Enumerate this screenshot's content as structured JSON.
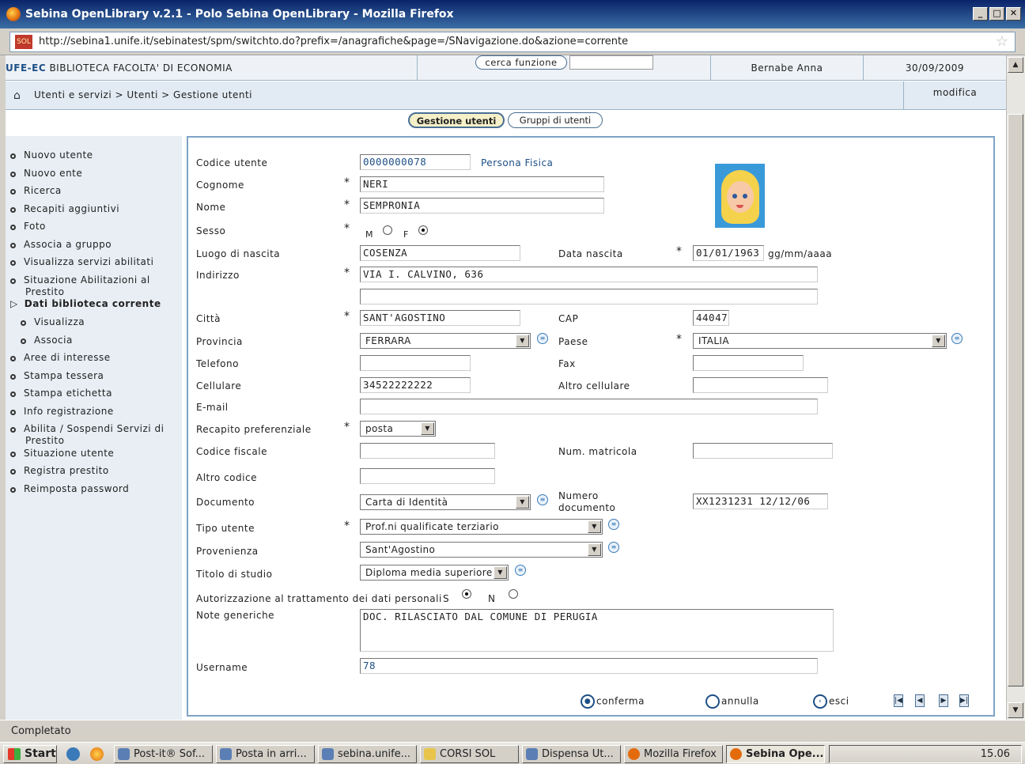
{
  "window": {
    "title": "Sebina OpenLibrary v.2.1 - Polo Sebina OpenLibrary - Mozilla Firefox"
  },
  "url": "http://sebina1.unife.it/sebinatest/spm/switchto.do?prefix=/anagrafiche&page=/SNavigazione.do&azione=corrente",
  "header": {
    "library_code": "UFE-EC",
    "library_name": "BIBLIOTECA FACOLTA' DI ECONOMIA",
    "search_label": "cerca funzione",
    "user": "Bernabe Anna",
    "date": "30/09/2009"
  },
  "breadcrumb": {
    "path": "Utenti e servizi > Utenti > Gestione utenti",
    "modify": "modifica"
  },
  "tabs": [
    "Gestione utenti",
    "Gruppi di utenti"
  ],
  "menu": [
    "Nuovo utente",
    "Nuovo ente",
    "Ricerca",
    "Recapiti aggiuntivi",
    "Foto",
    "Associa a gruppo",
    "Visualizza servizi abilitati",
    "Situazione Abilitazioni al Prestito",
    "Dati biblioteca corrente",
    "Visualizza",
    "Associa",
    "Aree di interesse",
    "Stampa tessera",
    "Stampa etichetta",
    "Info registrazione",
    "Abilita / Sospendi Servizi di Prestito",
    "Situazione utente",
    "Registra prestito",
    "Reimposta password"
  ],
  "form": {
    "codice_utente_label": "Codice utente",
    "codice_utente": "0000000078",
    "persona_fisica": "Persona Fisica",
    "cognome_label": "Cognome",
    "cognome": "NERI",
    "nome_label": "Nome",
    "nome": "SEMPRONIA",
    "sesso_label": "Sesso",
    "m": "M",
    "f": "F",
    "luogo_label": "Luogo di nascita",
    "luogo": "COSENZA",
    "data_label": "Data nascita",
    "data": "01/01/1963",
    "data_fmt": "gg/mm/aaaa",
    "indirizzo_label": "Indirizzo",
    "indirizzo": "VIA I. CALVINO, 636",
    "indirizzo2": "",
    "citta_label": "Città",
    "citta": "SANT'AGOSTINO",
    "cap_label": "CAP",
    "cap": "44047",
    "provincia_label": "Provincia",
    "provincia": "FERRARA",
    "paese_label": "Paese",
    "paese": "ITALIA",
    "telefono_label": "Telefono",
    "fax_label": "Fax",
    "cellulare_label": "Cellulare",
    "cellulare": "34522222222",
    "altro_cell_label": "Altro cellulare",
    "email_label": "E-mail",
    "recapito_label": "Recapito preferenziale",
    "recapito": "posta",
    "cf_label": "Codice fiscale",
    "matricola_label": "Num. matricola",
    "altro_codice_label": "Altro codice",
    "documento_label": "Documento",
    "documento": "Carta di Identità",
    "numdoc_label1": "Numero",
    "numdoc_label2": "documento",
    "numdoc": "XX1231231  12/12/06",
    "tipo_label": "Tipo utente",
    "tipo": "Prof.ni qualificate terziario",
    "provenienza_label": "Provenienza",
    "provenienza": "Sant'Agostino",
    "titolo_label": "Titolo di studio",
    "titolo": "Diploma media superiore",
    "autorizz_label": "Autorizzazione al trattamento dei dati personali",
    "s": "S",
    "n": "N",
    "note_label": "Note generiche",
    "note": "DOC. RILASCIATO DAL COMUNE DI PERUGIA",
    "username_label": "Username",
    "username": "78"
  },
  "actions": {
    "conferma": "conferma",
    "annulla": "annulla",
    "esci": "esci"
  },
  "status": "Completato",
  "taskbar": {
    "start": "Start",
    "items": [
      "Post-it® Sof...",
      "Posta in arri...",
      "sebina.unife...",
      "CORSI SOL",
      "Dispensa Ut...",
      "Mozilla Firefox",
      "Sebina Ope..."
    ],
    "clock": "15.06"
  }
}
